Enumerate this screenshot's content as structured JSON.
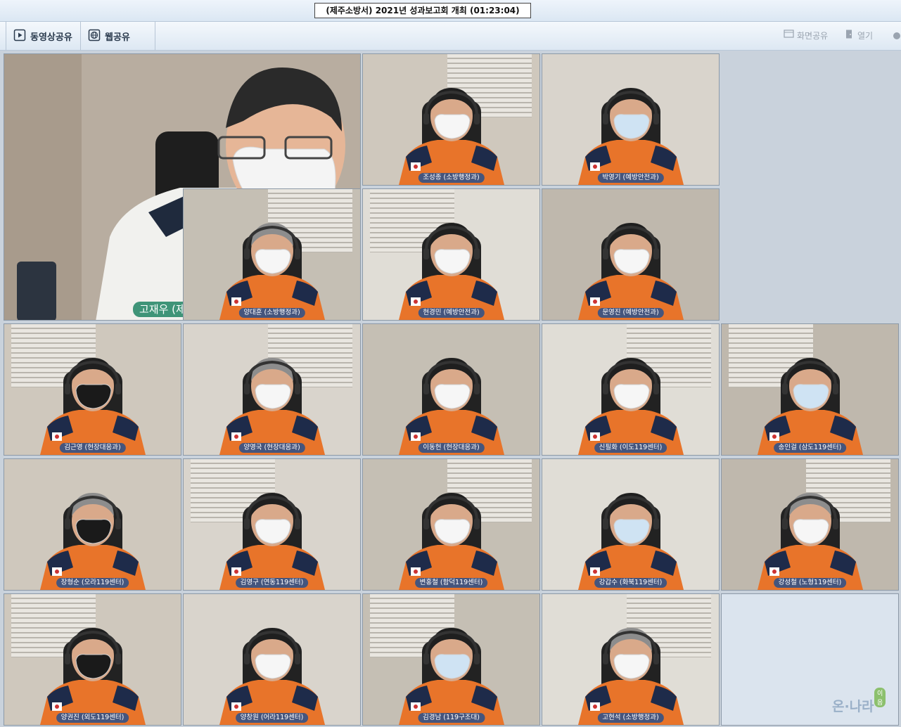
{
  "window": {
    "title": "(제주소방서) 2021년 성과보고회 개최 (01:23:04)"
  },
  "toolbar": {
    "video_share_label": "동영상공유",
    "web_share_label": "웹공유",
    "screen_share_label": "화면공유",
    "open_label": "열기"
  },
  "main_speaker": {
    "name": "고재우 (제주소방서)"
  },
  "logo": {
    "text": "온·나라",
    "badge": "이음"
  },
  "participants": [
    {
      "name": "조성종 (소방행정과)",
      "row": 0,
      "col": 2
    },
    {
      "name": "박영기 (예방안전과)",
      "row": 0,
      "col": 3
    },
    {
      "name": "양대훈 (소방행정과)",
      "row": 1,
      "col": 1
    },
    {
      "name": "현경민 (예방안전과)",
      "row": 1,
      "col": 2
    },
    {
      "name": "문영진 (예방안전과)",
      "row": 1,
      "col": 3
    },
    {
      "name": "김근영 (현장대응과)",
      "row": 2,
      "col": 0
    },
    {
      "name": "양영국 (현장대응과)",
      "row": 2,
      "col": 1
    },
    {
      "name": "이동헌 (현장대응과)",
      "row": 2,
      "col": 2
    },
    {
      "name": "신필화 (이도119센터)",
      "row": 2,
      "col": 3
    },
    {
      "name": "송인걸 (삼도119센터)",
      "row": 2,
      "col": 4
    },
    {
      "name": "장형순 (오라119센터)",
      "row": 3,
      "col": 0
    },
    {
      "name": "김영구 (연동119센터)",
      "row": 3,
      "col": 1
    },
    {
      "name": "변홍철 (함덕119센터)",
      "row": 3,
      "col": 2
    },
    {
      "name": "강갑수 (화북119센터)",
      "row": 3,
      "col": 3
    },
    {
      "name": "강성철 (노형119센터)",
      "row": 3,
      "col": 4
    },
    {
      "name": "양권진 (외도119센터)",
      "row": 4,
      "col": 0
    },
    {
      "name": "양창원 (어라119센터)",
      "row": 4,
      "col": 1
    },
    {
      "name": "김경남 (119구조대)",
      "row": 4,
      "col": 2
    },
    {
      "name": "고현석 (소방행정과)",
      "row": 4,
      "col": 3
    }
  ],
  "colors": {
    "uniform_orange": "#e8742a",
    "uniform_navy": "#1e2b4a",
    "name_tag_bg": "#28508c",
    "speaker_tag_bg": "#308c6e"
  }
}
